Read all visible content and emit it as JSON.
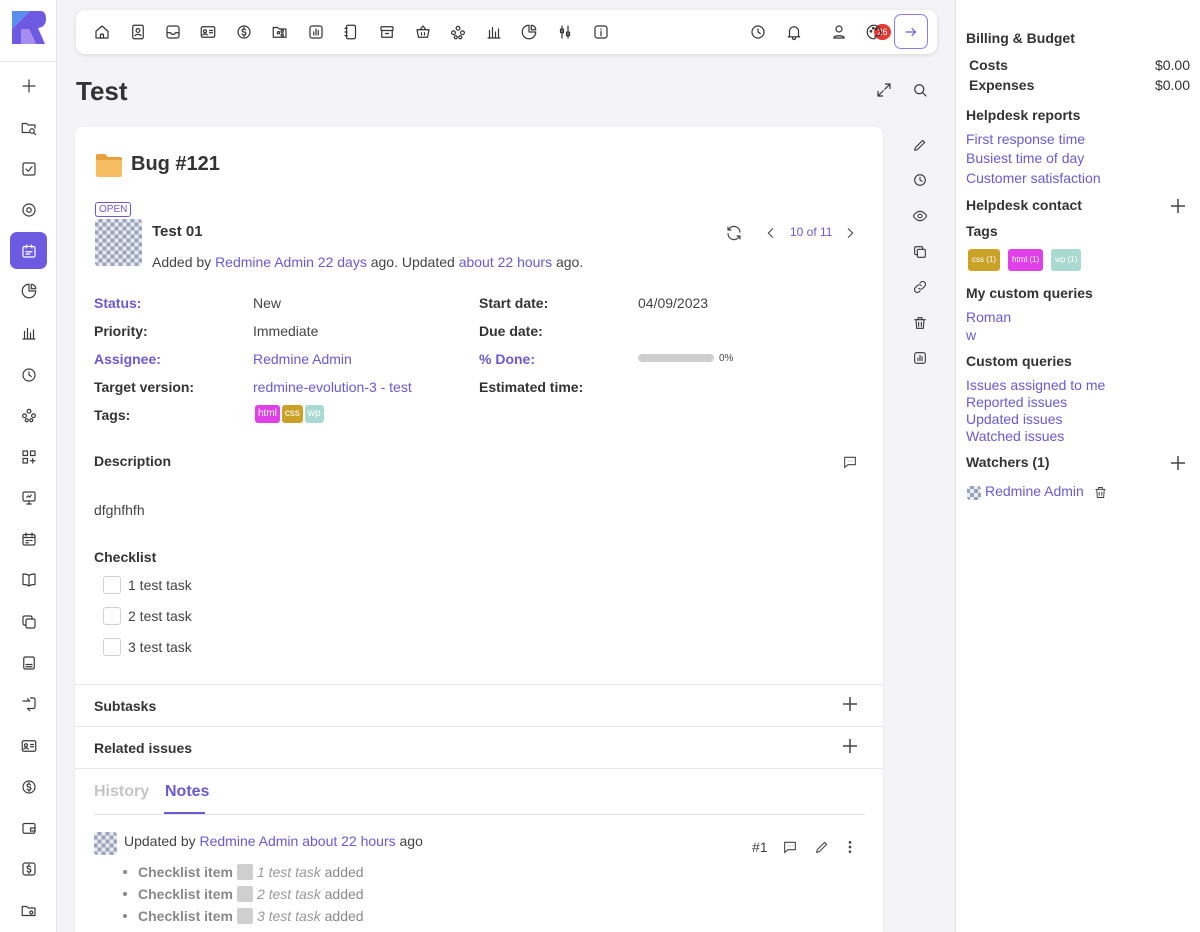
{
  "toolbar": {
    "icons": [
      "home-icon",
      "contacts-icon",
      "inbox-icon",
      "id-card-icon",
      "dollar-icon",
      "folder-share-icon",
      "chart-box-icon",
      "notebook-icon",
      "archive-icon",
      "basket-icon",
      "people-icon",
      "bar-chart-icon",
      "pie-chart-icon",
      "sliders-icon",
      "info-icon",
      "clock-icon",
      "bell-icon",
      "user-icon",
      "palette-icon",
      "exit-icon"
    ],
    "notifications_count": "26"
  },
  "page": {
    "title": "Test"
  },
  "issue": {
    "tracker_title": "Bug #121",
    "status_badge": "OPEN",
    "subject": "Test 01",
    "added_prefix": "Added by",
    "author": "Redmine Admin",
    "added_ago": "22 days",
    "updated_text": "ago. Updated",
    "updated_ago": "about 22 hours",
    "ago_suffix": "ago.",
    "position": "10 of 11",
    "attributes": {
      "status_label": "Status:",
      "status_value": "New",
      "priority_label": "Priority:",
      "priority_value": "Immediate",
      "assignee_label": "Assignee:",
      "assignee_value": "Redmine Admin",
      "target_label": "Target version:",
      "target_value": "redmine-evolution-3 - test",
      "tags_label": "Tags:",
      "start_label": "Start date:",
      "start_value": "04/09/2023",
      "due_label": "Due date:",
      "due_value": "",
      "done_label": "% Done:",
      "done_value": "0%",
      "done_fraction": 0,
      "estimated_label": "Estimated time:",
      "estimated_value": ""
    },
    "tags": [
      "html",
      "css",
      "wp"
    ],
    "description_title": "Description",
    "description_text": "dfghfhfh",
    "checklist_title": "Checklist",
    "checklist": [
      "1 test task",
      "2 test task",
      "3 test task"
    ],
    "subtasks_title": "Subtasks",
    "related_title": "Related issues",
    "tabs": {
      "history": "History",
      "notes": "Notes"
    },
    "note": {
      "updated_prefix": "Updated by",
      "author": "Redmine Admin",
      "ago": "about 22 hours",
      "ago_suffix": "ago",
      "number": "#1",
      "item_label": "Checklist item",
      "items": [
        "1 test task",
        "2 test task",
        "3 test task"
      ],
      "added": "added"
    }
  },
  "sidebar": {
    "billing_title": "Billing & Budget",
    "costs_label": "Costs",
    "costs_value": "$0.00",
    "expenses_label": "Expenses",
    "expenses_value": "$0.00",
    "helpdesk_reports_title": "Helpdesk reports",
    "helpdesk_reports": [
      "First response time",
      "Busiest time of day",
      "Customer satisfaction"
    ],
    "helpdesk_contact_title": "Helpdesk contact",
    "tags_title": "Tags",
    "tags": [
      {
        "name": "css",
        "count": "(1)"
      },
      {
        "name": "html",
        "count": "(1)"
      },
      {
        "name": "wp",
        "count": "(1)"
      }
    ],
    "my_queries_title": "My custom queries",
    "my_queries": [
      "Roman",
      "w"
    ],
    "custom_queries_title": "Custom queries",
    "custom_queries": [
      "Issues assigned to me",
      "Reported issues",
      "Updated issues",
      "Watched issues"
    ],
    "watchers_title": "Watchers (1)",
    "watcher": "Redmine Admin"
  },
  "colors": {
    "accent": "#6a5acd",
    "active_nav": "#6d5ae0",
    "badge": "#e53935",
    "tag_html": "#e040e8",
    "tag_css": "#c9a227",
    "tag_wp": "#a9d9d0"
  }
}
